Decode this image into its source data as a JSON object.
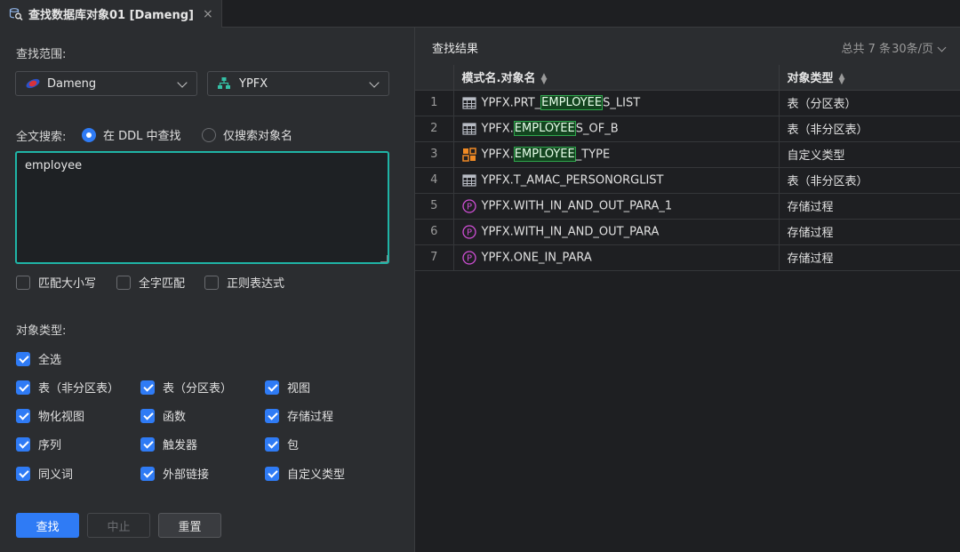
{
  "tab": {
    "title": "查找数据库对象01 [Dameng]",
    "close": "×",
    "icon": "db-search-icon"
  },
  "search": {
    "scope_label": "查找范围:",
    "connection": "Dameng",
    "schema": "YPFX",
    "fulltext_label": "全文搜索:",
    "radio_ddl": "在 DDL 中查找",
    "radio_name": "仅搜索对象名",
    "radio_selected": "ddl",
    "keyword": "employee",
    "opt_case": "匹配大小写",
    "opt_whole": "全字匹配",
    "opt_regex": "正则表达式",
    "type_label": "对象类型:",
    "select_all": "全选",
    "types": [
      "表（非分区表）",
      "表（分区表）",
      "视图",
      "物化视图",
      "函数",
      "存储过程",
      "序列",
      "触发器",
      "包",
      "同义词",
      "外部链接",
      "自定义类型"
    ],
    "btn_find": "查找",
    "btn_stop": "中止",
    "btn_reset": "重置"
  },
  "results": {
    "title": "查找结果",
    "total": "总共 7 条",
    "page_size": "30条/页",
    "columns": {
      "name": "模式名.对象名",
      "type": "对象类型"
    },
    "rows": [
      {
        "n": "1",
        "icon": "table-icon",
        "pre": "YPFX.PRT_",
        "hl": "EMPLOYEE",
        "post": "S_LIST",
        "type": "表（分区表）"
      },
      {
        "n": "2",
        "icon": "table-icon",
        "pre": "YPFX.",
        "hl": "EMPLOYEE",
        "post": "S_OF_B",
        "type": "表（非分区表）"
      },
      {
        "n": "3",
        "icon": "custom-type-icon",
        "pre": "YPFX.",
        "hl": "EMPLOYEE",
        "post": "_TYPE",
        "type": "自定义类型"
      },
      {
        "n": "4",
        "icon": "table-icon",
        "pre": "YPFX.T_AMAC_PERSONORGLIST",
        "hl": "",
        "post": "",
        "type": "表（非分区表）"
      },
      {
        "n": "5",
        "icon": "procedure-icon",
        "pre": "YPFX.WITH_IN_AND_OUT_PARA_1",
        "hl": "",
        "post": "",
        "type": "存储过程"
      },
      {
        "n": "6",
        "icon": "procedure-icon",
        "pre": "YPFX.WITH_IN_AND_OUT_PARA",
        "hl": "",
        "post": "",
        "type": "存储过程"
      },
      {
        "n": "7",
        "icon": "procedure-icon",
        "pre": "YPFX.ONE_IN_PARA",
        "hl": "",
        "post": "",
        "type": "存储过程"
      }
    ]
  },
  "colors": {
    "accent": "#2f7bf5",
    "textarea_border": "#1fb4a6",
    "highlight": "#2fa64c"
  }
}
